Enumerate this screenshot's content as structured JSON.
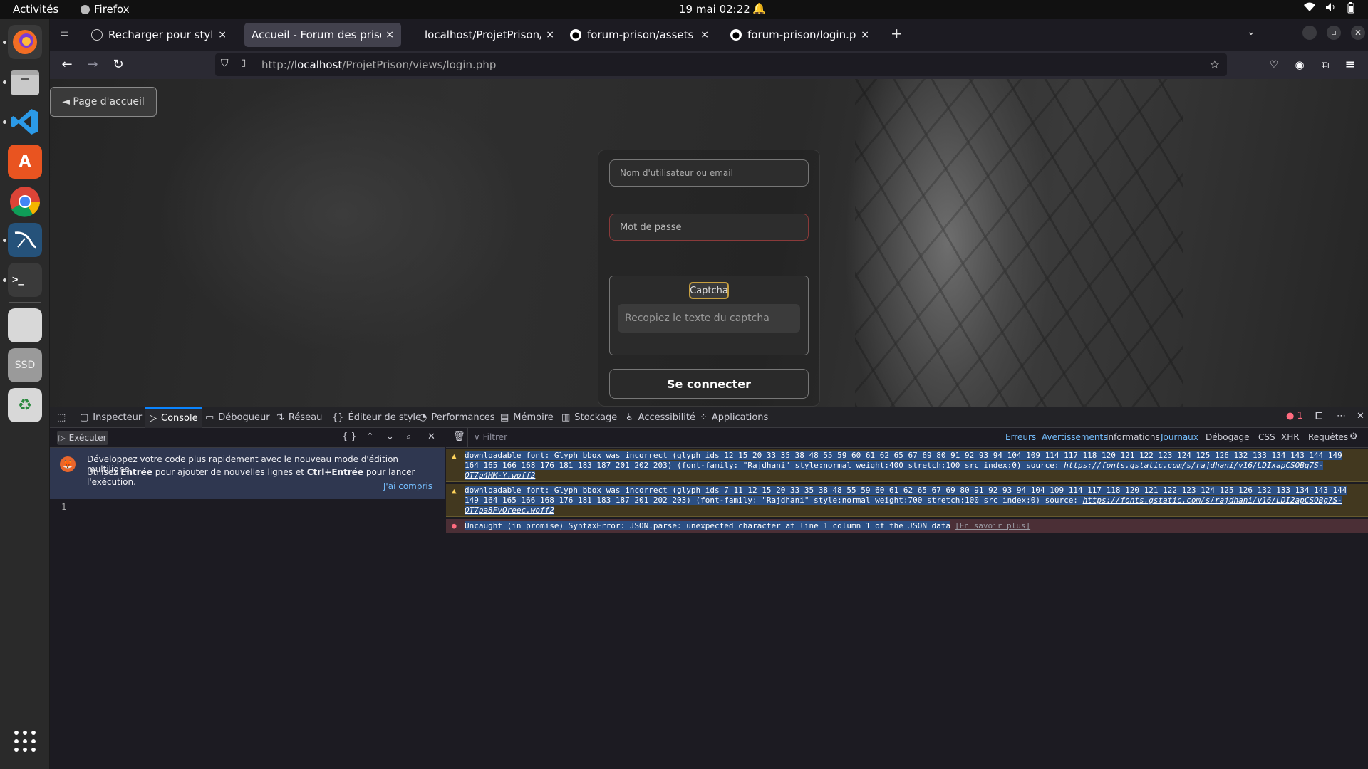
{
  "system": {
    "activities": "Activités",
    "app_name": "Firefox",
    "datetime": "19 mai  02:22"
  },
  "browser": {
    "tabs": [
      {
        "title": "Recharger pour styles CS",
        "close": "×"
      },
      {
        "title": "Accueil - Forum des prisonni",
        "close": "×"
      },
      {
        "title": "localhost/ProjetPrison/aj",
        "close": "×"
      },
      {
        "title": "forum-prison/assets at m",
        "close": "×"
      },
      {
        "title": "forum-prison/login.php a",
        "close": "×"
      }
    ],
    "new_tab": "+",
    "url_host": "localhost",
    "url_prefix": "http://",
    "url_path": "/ProjetPrison/views/login.php"
  },
  "page": {
    "home_button": "◄ Page d'accueil",
    "username_placeholder": "Nom d'utilisateur ou email",
    "password_placeholder": "Mot de passe",
    "captcha_label": "Captcha",
    "captcha_placeholder": "Recopiez le texte du captcha",
    "login_button": "Se connecter"
  },
  "devtools": {
    "tabs": [
      "Inspecteur",
      "Console",
      "Débogueur",
      "Réseau",
      "Éditeur de style",
      "Performances",
      "Mémoire",
      "Stockage",
      "Accessibilité",
      "Applications"
    ],
    "active_tab": "Console",
    "error_count": "1",
    "execute_label": "Exécuter",
    "notice_line1": "Développez votre code plus rapidement avec le nouveau mode d'édition multiligne.",
    "notice_line2_a": "Utilisez ",
    "notice_line2_b": "Entrée",
    "notice_line2_c": " pour ajouter de nouvelles lignes et ",
    "notice_line2_d": "Ctrl+Entrée",
    "notice_line2_e": " pour lancer l'exécution.",
    "notice_ok": "J'ai compris",
    "line_number": "1",
    "filter_placeholder": "Filtrer",
    "filters": [
      {
        "label": "Erreurs",
        "on": true
      },
      {
        "label": "Avertissements",
        "on": true
      },
      {
        "label": "Informations",
        "on": false
      },
      {
        "label": "Journaux",
        "on": true
      },
      {
        "label": "Débogage",
        "on": false
      },
      {
        "label": "CSS",
        "on": false
      },
      {
        "label": "XHR",
        "on": false
      },
      {
        "label": "Requêtes",
        "on": false
      }
    ],
    "messages": [
      {
        "level": "warning",
        "text": "downloadable font: Glyph bbox was incorrect (glyph ids 12 15 20 33 35 38 48 55 59 60 61 62 65 67 69 80 91 92 93 94 104 109 114 117 118 120 121 122 123 124 125 126 132 133 134 143 144 149 164 165 166 168 176 181 183 187 201 202 203) (font-family: \"Rajdhani\" style:normal weight:400 stretch:100 src index:0) source: ",
        "link": "https://fonts.gstatic.com/s/rajdhani/v16/LDIxapCSOBg7S-QT7p4HM-Y.woff2"
      },
      {
        "level": "warning",
        "text": "downloadable font: Glyph bbox was incorrect (glyph ids 7 11 12 15 20 33 35 38 48 55 59 60 61 62 65 67 69 80 91 92 93 94 104 109 114 117 118 120 121 122 123 124 125 126 132 133 134 143 144 149 164 165 166 168 176 181 183 187 201 202 203) (font-family: \"Rajdhani\" style:normal weight:700 stretch:100 src index:0) source: ",
        "link": "https://fonts.gstatic.com/s/rajdhani/v16/LDI2apCSOBg7S-QT7pa8FvOreec.woff2"
      },
      {
        "level": "error",
        "text": "Uncaught (in promise) SyntaxError: JSON.parse: unexpected character at line 1 column 1 of the JSON data",
        "learn_more": "[En savoir plus]"
      }
    ]
  }
}
